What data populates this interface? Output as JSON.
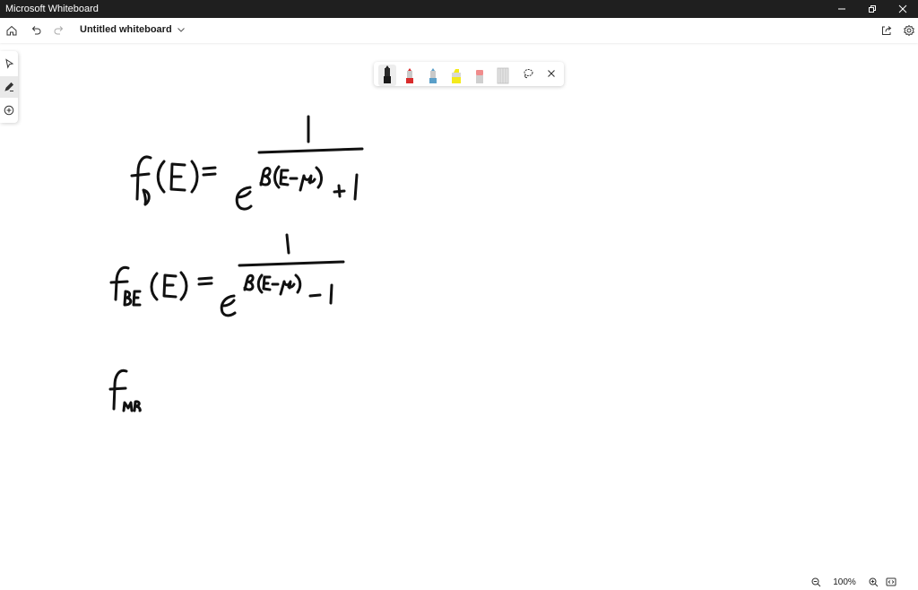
{
  "window": {
    "title": "Microsoft Whiteboard"
  },
  "appbar": {
    "board_title": "Untitled whiteboard"
  },
  "icons": {
    "home": "home-icon",
    "undo": "undo-icon",
    "redo": "redo-icon",
    "share": "share-icon",
    "settings": "gear-icon",
    "select": "select-pointer-icon",
    "inking": "pen-icon",
    "add": "add-circle-icon",
    "lasso": "lasso-icon",
    "close": "close-icon",
    "zoom_out": "zoom-out-icon",
    "zoom_in": "zoom-in-icon",
    "fit": "fit-to-screen-icon"
  },
  "pens": [
    {
      "name": "black-pen",
      "color": "#1a1a1a"
    },
    {
      "name": "red-pen",
      "color": "#d92c2c"
    },
    {
      "name": "blue-pen",
      "color": "#5a9fc9"
    },
    {
      "name": "yellow-highlighter",
      "color": "#f4ea1c"
    },
    {
      "name": "pink-eraser",
      "color": "#f08c8c"
    },
    {
      "name": "ruler",
      "color": "#c8c8c8"
    }
  ],
  "ink": {
    "color": "#111111"
  },
  "zoom": {
    "level": "100%"
  }
}
